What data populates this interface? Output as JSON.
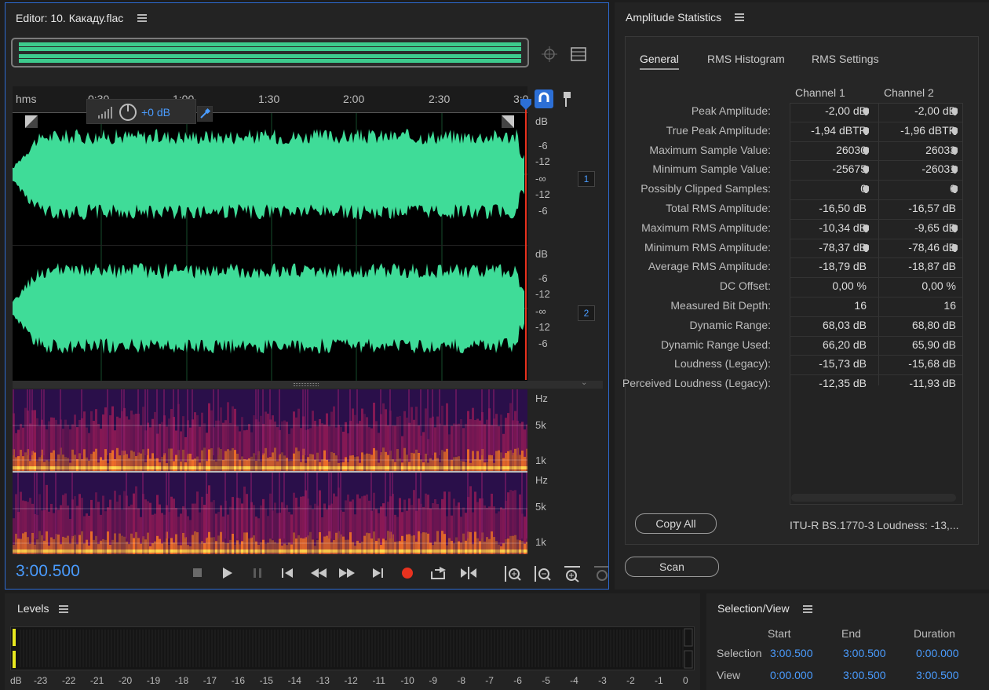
{
  "editor": {
    "title": "Editor: 10. Какаду.flac",
    "ruler": {
      "unit": "hms",
      "labels": [
        "0:30",
        "1:00",
        "1:30",
        "2:00",
        "2:30",
        "3:0"
      ]
    },
    "hud": {
      "gain": "+0 dB"
    },
    "channel1": {
      "badge": "1",
      "db_labels": [
        "dB",
        "-6",
        "-12",
        "-∞",
        "-12",
        "-6"
      ]
    },
    "channel2": {
      "badge": "2",
      "db_labels": [
        "dB",
        "-6",
        "-12",
        "-∞",
        "-12",
        "-6"
      ]
    },
    "spectral1": {
      "hz_labels": [
        "Hz",
        "5k",
        "1k"
      ]
    },
    "spectral2": {
      "hz_labels": [
        "Hz",
        "5k",
        "1k"
      ]
    },
    "time_display": "3:00.500",
    "colors": {
      "waveform": "#3fdc98",
      "accent": "#4a9cff",
      "playhead": "#e8321f"
    }
  },
  "stats": {
    "title": "Amplitude Statistics",
    "tabs": [
      "General",
      "RMS Histogram",
      "RMS Settings"
    ],
    "col_headers": [
      "Channel 1",
      "Channel 2"
    ],
    "rows": [
      {
        "label": "Peak Amplitude:",
        "c1": "-2,00 dB",
        "c2": "-2,00 dB",
        "pin": true
      },
      {
        "label": "True Peak Amplitude:",
        "c1": "-1,94 dBTP",
        "c2": "-1,96 dBTP",
        "pin": true
      },
      {
        "label": "Maximum Sample Value:",
        "c1": "26030",
        "c2": "26033",
        "pin": true
      },
      {
        "label": "Minimum Sample Value:",
        "c1": "-25675",
        "c2": "-26031",
        "pin": true
      },
      {
        "label": "Possibly Clipped Samples:",
        "c1": "0",
        "c2": "0",
        "pin": true
      },
      {
        "label": "Total RMS Amplitude:",
        "c1": "-16,50 dB",
        "c2": "-16,57 dB",
        "pin": false
      },
      {
        "label": "Maximum RMS Amplitude:",
        "c1": "-10,34 dB",
        "c2": "-9,65 dB",
        "pin": true
      },
      {
        "label": "Minimum RMS Amplitude:",
        "c1": "-78,37 dB",
        "c2": "-78,46 dB",
        "pin": true
      },
      {
        "label": "Average RMS Amplitude:",
        "c1": "-18,79 dB",
        "c2": "-18,87 dB",
        "pin": false
      },
      {
        "label": "DC Offset:",
        "c1": "0,00 %",
        "c2": "0,00 %",
        "pin": false
      },
      {
        "label": "Measured Bit Depth:",
        "c1": "16",
        "c2": "16",
        "pin": false
      },
      {
        "label": "Dynamic Range:",
        "c1": "68,03 dB",
        "c2": "68,80 dB",
        "pin": false
      },
      {
        "label": "Dynamic Range Used:",
        "c1": "66,20 dB",
        "c2": "65,90 dB",
        "pin": false
      },
      {
        "label": "Loudness (Legacy):",
        "c1": "-15,73 dB",
        "c2": "-15,68 dB",
        "pin": false
      },
      {
        "label": "Perceived Loudness (Legacy):",
        "c1": "-12,35 dB",
        "c2": "-11,93 dB",
        "pin": false
      }
    ],
    "copy_all": "Copy All",
    "itu_loudness": "ITU-R BS.1770-3 Loudness:  -13,...",
    "scan": "Scan"
  },
  "levels": {
    "title": "Levels",
    "scale": [
      "dB",
      "-23",
      "-22",
      "-21",
      "-20",
      "-19",
      "-18",
      "-17",
      "-16",
      "-15",
      "-14",
      "-13",
      "-12",
      "-11",
      "-10",
      "-9",
      "-8",
      "-7",
      "-6",
      "-5",
      "-4",
      "-3",
      "-2",
      "-1",
      "0"
    ]
  },
  "selview": {
    "title": "Selection/View",
    "headers": [
      "Start",
      "End",
      "Duration"
    ],
    "selection": {
      "label": "Selection",
      "start": "3:00.500",
      "end": "3:00.500",
      "duration": "0:00.000"
    },
    "view": {
      "label": "View",
      "start": "0:00.000",
      "end": "3:00.500",
      "duration": "3:00.500"
    }
  }
}
